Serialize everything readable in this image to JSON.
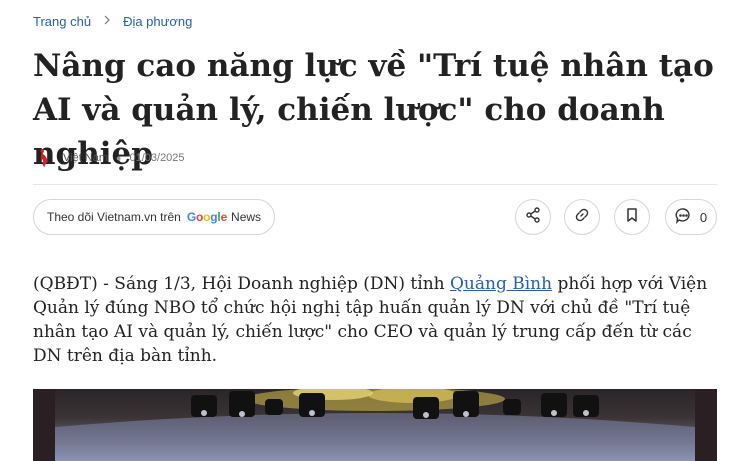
{
  "breadcrumb": {
    "home": "Trang chủ",
    "section": "Địa phương"
  },
  "article": {
    "title": "Nâng cao năng lực về \"Trí tuệ nhân tạo AI và quản lý, chiến lược\" cho doanh nghiệp",
    "source": "Việt Nam",
    "date": "01/03/2025",
    "intro_before": "(QBĐT) - Sáng 1/3, Hội Doanh nghiệp (DN) tỉnh ",
    "intro_link": "Quảng Bình",
    "intro_after": " phối hợp với Viện Quản lý đúng NBO tổ chức hội nghị tập huấn quản lý DN với chủ đề \"Trí tuệ nhân tạo AI và quản lý, chiến lược\" cho CEO và quản lý trung cấp đến từ các DN trên địa bàn tỉnh."
  },
  "follow": {
    "label": "Theo dõi Vietnam.vn trên",
    "google_letters": [
      "G",
      "o",
      "o",
      "g",
      "l",
      "e"
    ],
    "news": "News"
  },
  "actions": {
    "comment_count": "0"
  },
  "icons": {
    "share": "share-icon",
    "link": "link-icon",
    "bookmark": "bookmark-icon",
    "comment": "comment-icon",
    "chevron": "chevron-right-icon",
    "logo": "vietnam-map-logo"
  },
  "colors": {
    "link": "#2a5ea8",
    "accent": "#d61f26"
  }
}
